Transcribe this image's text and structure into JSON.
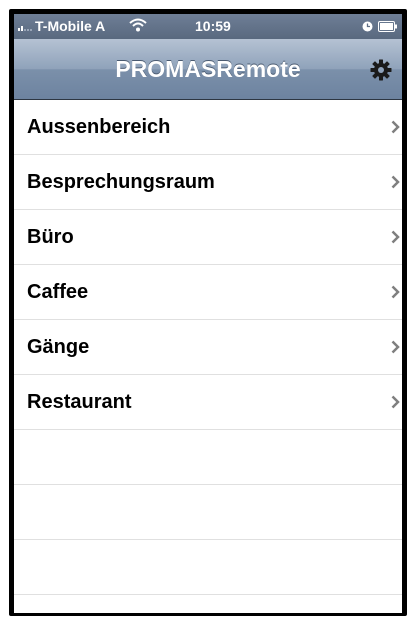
{
  "status_bar": {
    "carrier": "T-Mobile A",
    "time": "10:59",
    "signal_icon": "signal-bars-icon",
    "wifi_icon": "wifi-icon",
    "alarm_icon": "alarm-icon",
    "battery_icon": "battery-icon"
  },
  "nav_bar": {
    "title": "PROMASRemote",
    "settings_icon": "gear-icon"
  },
  "rooms": [
    {
      "label": "Aussenbereich"
    },
    {
      "label": "Besprechungsraum"
    },
    {
      "label": "Büro"
    },
    {
      "label": "Caffee"
    },
    {
      "label": "Gänge"
    },
    {
      "label": "Restaurant"
    }
  ],
  "colors": {
    "nav_bar": "#8fa2ba",
    "status_bar": "#5f6f86",
    "chevron": "#7f7f7f",
    "separator": "#e0e0e0"
  }
}
